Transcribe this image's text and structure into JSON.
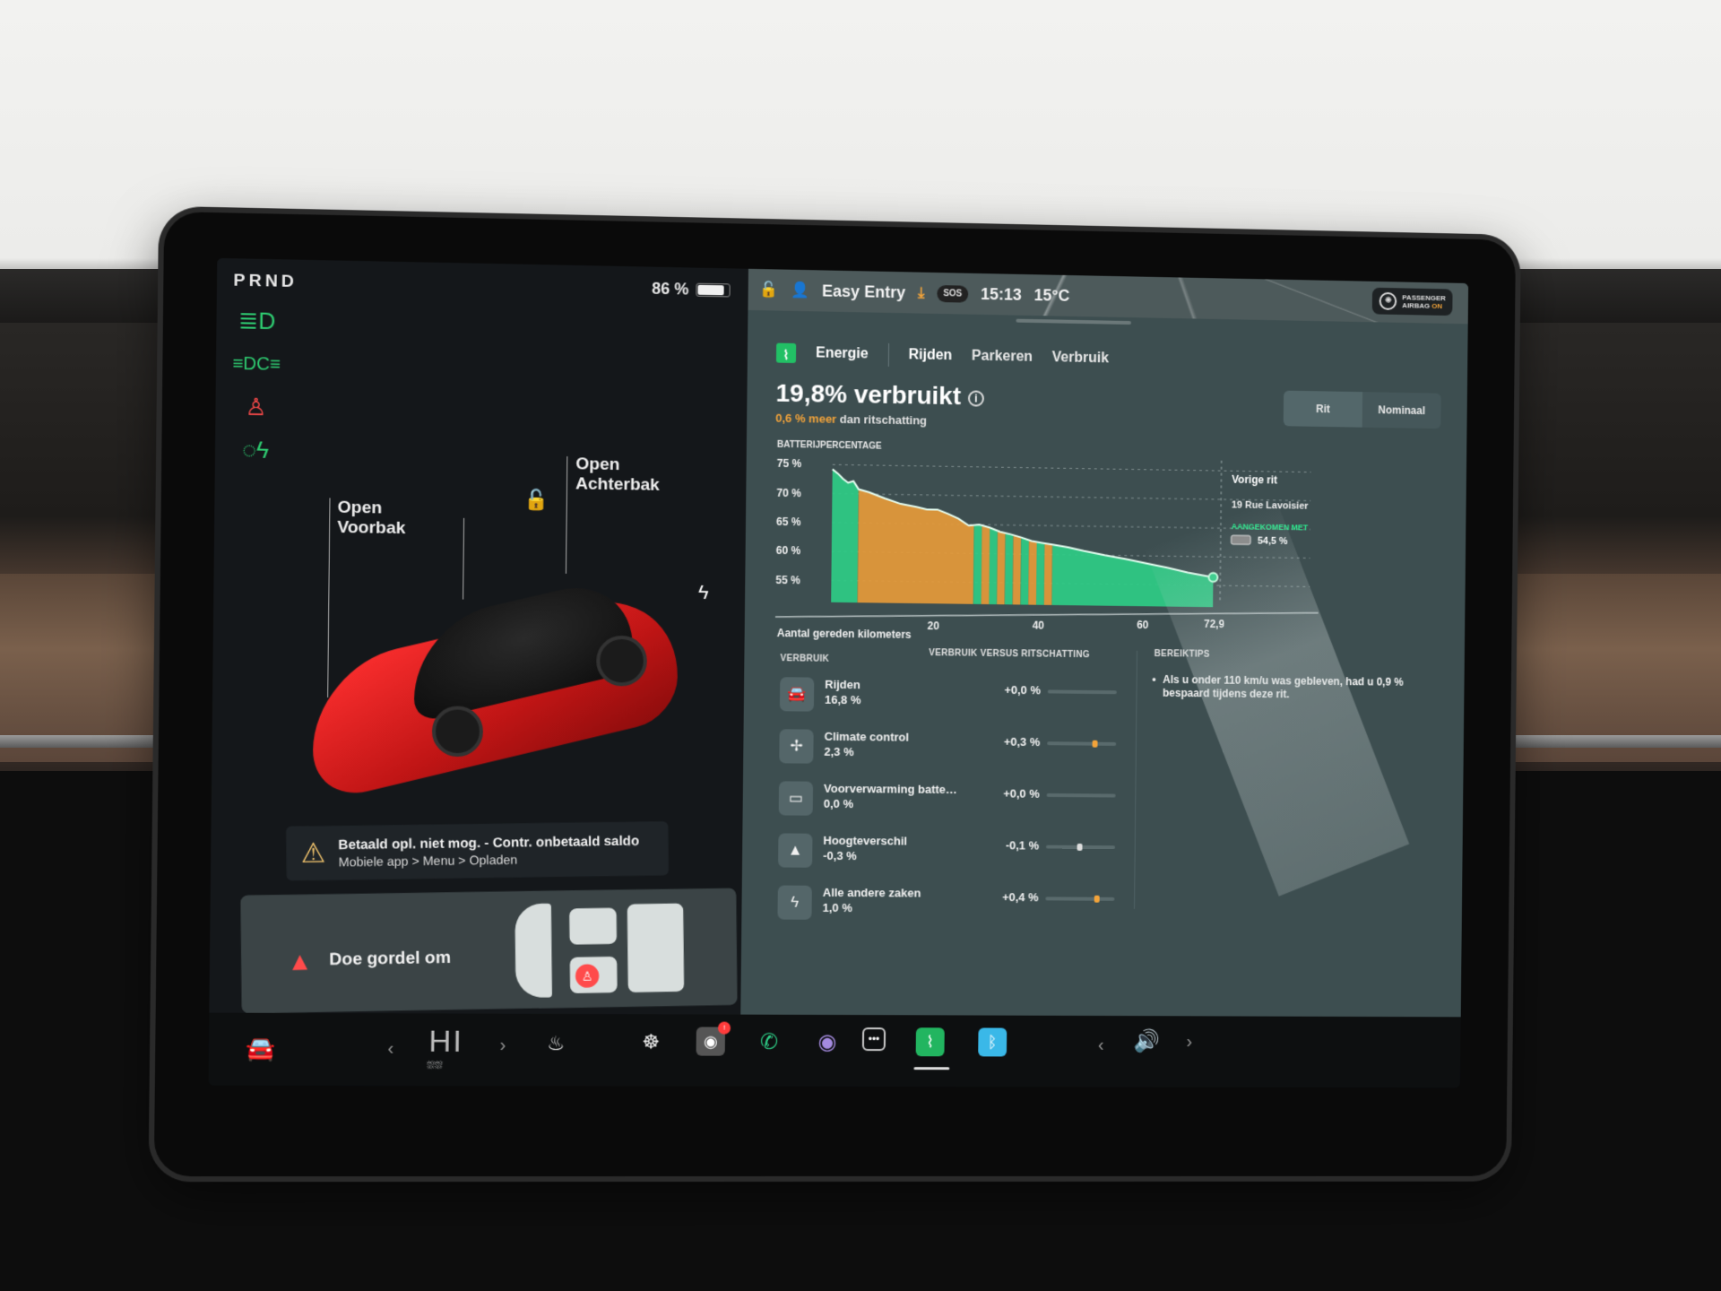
{
  "status": {
    "gear": "PRND",
    "battery_percent": "86 %",
    "battery_level": 0.86,
    "time": "15:13",
    "temperature": "15°C",
    "profile": "Easy Entry",
    "sos": "SOS",
    "airbag": {
      "line1": "PASSENGER",
      "line2": "AIRBAG",
      "state": "ON"
    }
  },
  "car_view": {
    "frunk_label_1": "Open",
    "frunk_label_2": "Voorbak",
    "trunk_label_1": "Open",
    "trunk_label_2": "Achterbak"
  },
  "alerts": {
    "charging": {
      "title": "Betaald opl. niet mog. - Contr. onbetaald saldo",
      "detail": "Mobiele app > Menu > Opladen"
    },
    "seatbelt": {
      "message": "Doe gordel om"
    }
  },
  "energy": {
    "tabs": [
      {
        "label": "Energie"
      },
      {
        "label": "Rijden"
      },
      {
        "label": "Parkeren"
      },
      {
        "label": "Verbruik"
      }
    ],
    "headline": "19,8% verbruikt",
    "sub_highlight": "0,6 % meer",
    "sub_rest": " dan ritschatting",
    "toggle": [
      {
        "label": "Rit",
        "selected": true
      },
      {
        "label": "Nominaal",
        "selected": false
      }
    ],
    "consumption_header": "VERBRUIK",
    "vs_header": "VERBRUIK VERSUS RITSCHATTING",
    "tips_header": "BEREIKTIPS",
    "tip": "Als u onder 110 km/u was gebleven, had u 0,9 % bespaard tijdens deze rit.",
    "items": [
      {
        "icon": "car-icon",
        "glyph": "🚘",
        "name": "Rijden",
        "value": "16,8 %",
        "delta": "+0,0 %",
        "delta_num": 0.0
      },
      {
        "icon": "fan-icon",
        "glyph": "✢",
        "name": "Climate control",
        "value": "2,3 %",
        "delta": "+0,3 %",
        "delta_num": 0.3
      },
      {
        "icon": "battery-icon",
        "glyph": "▭",
        "name": "Voorverwarming batte…",
        "value": "0,0 %",
        "delta": "+0,0 %",
        "delta_num": 0.0
      },
      {
        "icon": "mountain-icon",
        "glyph": "▲",
        "name": "Hoogteverschil",
        "value": "-0,3 %",
        "delta": "-0,1 %",
        "delta_num": -0.1
      },
      {
        "icon": "bolt-icon",
        "glyph": "ϟ",
        "name": "Alle andere zaken",
        "value": "1,0 %",
        "delta": "+0,4 %",
        "delta_num": 0.4
      }
    ]
  },
  "chart_data": {
    "type": "area",
    "title": "BATTERIJPERCENTAGE",
    "xlabel": "Aantal gereden kilometers",
    "ylabel": "Batterijpercentage",
    "x_ticks": [
      "20",
      "40",
      "60",
      "72,9"
    ],
    "x_tick_values": [
      20,
      40,
      60,
      72.9
    ],
    "y_ticks": [
      "75 %",
      "70 %",
      "65 %",
      "60 %",
      "55 %"
    ],
    "y_tick_values": [
      75,
      70,
      65,
      60,
      55
    ],
    "xlim": [
      0,
      72.9
    ],
    "ylim": [
      52,
      76
    ],
    "grid": true,
    "series": [
      {
        "name": "Batterijpercentage",
        "x": [
          0,
          1,
          2,
          3,
          4,
          5,
          7,
          10,
          13,
          16,
          18,
          20,
          22,
          24,
          26,
          28,
          30,
          32,
          34,
          36,
          38,
          40,
          42,
          45,
          48,
          52,
          56,
          60,
          64,
          68,
          72.9
        ],
        "y": [
          74.2,
          73.5,
          72.6,
          71.9,
          72.2,
          70.8,
          70.3,
          69.3,
          68.4,
          67.9,
          67.5,
          67.5,
          66.8,
          66.0,
          64.8,
          65.0,
          64.5,
          63.8,
          63.4,
          62.9,
          62.3,
          62.0,
          61.7,
          61.3,
          60.7,
          60.0,
          59.4,
          58.7,
          58.0,
          57.2,
          56.4
        ]
      }
    ],
    "segments": [
      {
        "from": 0,
        "to": 5,
        "color": "#2ecc86",
        "meaning": "below estimate"
      },
      {
        "from": 5,
        "to": 27,
        "color": "#e59a3a",
        "meaning": "above estimate"
      },
      {
        "from": 27,
        "to": 42,
        "color": "mixed",
        "meaning": "alternating"
      },
      {
        "from": 42,
        "to": 72.9,
        "color": "#2ecc86",
        "meaning": "below estimate"
      }
    ],
    "annotation": {
      "title": "Vorige rit",
      "destination": "19 Rue Lavoisier",
      "arrived_label": "AANGEKOMEN MET",
      "arrived_value": "54,5 %"
    }
  },
  "dock": {
    "climate_temp": "HI",
    "apps": [
      {
        "name": "camera",
        "badge": "!"
      },
      {
        "name": "phone"
      },
      {
        "name": "dashcam"
      },
      {
        "name": "more"
      },
      {
        "name": "energy",
        "active": true
      },
      {
        "name": "bluetooth"
      }
    ]
  },
  "colors": {
    "green": "#2ecc86",
    "orange": "#e59a3a",
    "red": "#ff4b4b",
    "panel": "#3d4e50"
  }
}
